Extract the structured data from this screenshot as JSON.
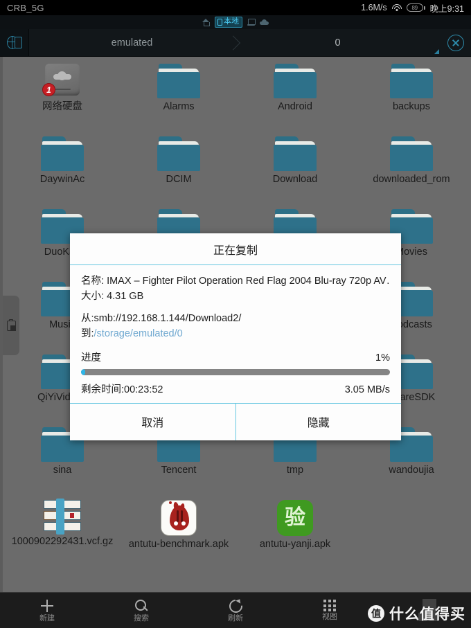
{
  "status_bar": {
    "carrier": "CRB_5G",
    "network_speed": "1.6M/s",
    "wifi_icon": "wifi-icon",
    "battery_level": "89",
    "clock": "晚上9:31"
  },
  "tab_strip": {
    "items": [
      {
        "icon": "home-icon",
        "label": "",
        "active": false
      },
      {
        "icon": "phone-icon",
        "label": "本地",
        "active": true
      },
      {
        "icon": "pc-icon",
        "label": "",
        "active": false
      },
      {
        "icon": "cloud-icon",
        "label": "",
        "active": false
      }
    ]
  },
  "path_bar": {
    "left_icon": "globe-device-icon",
    "crumbs": [
      "emulated",
      "0"
    ],
    "close_icon": "close-circle-icon"
  },
  "side_handle": {
    "icon": "clipboard-icon"
  },
  "files": [
    {
      "name": "网络硬盘",
      "type": "network-drive",
      "badge": "1"
    },
    {
      "name": "Alarms",
      "type": "folder"
    },
    {
      "name": "Android",
      "type": "folder"
    },
    {
      "name": "backups",
      "type": "folder"
    },
    {
      "name": "DaywinAc",
      "type": "folder"
    },
    {
      "name": "DCIM",
      "type": "folder"
    },
    {
      "name": "Download",
      "type": "folder"
    },
    {
      "name": "downloaded_rom",
      "type": "folder"
    },
    {
      "name": "DuoKan",
      "type": "folder"
    },
    {
      "name": "",
      "type": "folder"
    },
    {
      "name": "",
      "type": "folder"
    },
    {
      "name": "Movies",
      "type": "folder"
    },
    {
      "name": "Music",
      "type": "folder"
    },
    {
      "name": "",
      "type": "folder"
    },
    {
      "name": "",
      "type": "folder"
    },
    {
      "name": "Podcasts",
      "type": "folder"
    },
    {
      "name": "QiYiVideo_",
      "type": "folder"
    },
    {
      "name": "",
      "type": "folder"
    },
    {
      "name": "",
      "type": "folder"
    },
    {
      "name": "ShareSDK",
      "type": "folder"
    },
    {
      "name": "sina",
      "type": "folder"
    },
    {
      "name": "Tencent",
      "type": "folder"
    },
    {
      "name": "tmp",
      "type": "folder"
    },
    {
      "name": "wandoujia",
      "type": "folder"
    },
    {
      "name": "1000902292431.vcf.gz",
      "type": "vcf"
    },
    {
      "name": "antutu-benchmark.apk",
      "type": "apk-antutu"
    },
    {
      "name": "antutu-yanji.apk",
      "type": "apk-yanji",
      "glyph": "验"
    }
  ],
  "dialog": {
    "title": "正在复制",
    "name_label": "名称:",
    "name_value": "IMAX – Fighter Pilot  Operation Red Flag  2004  Blu-ray 720p AV…",
    "size_label": "大小:",
    "size_value": "4.31 GB",
    "from_label": "从:",
    "from_value": "smb://192.168.1.144/Download2/",
    "to_label": "到:",
    "to_value": "/storage/emulated/0",
    "progress_label": "进度",
    "progress_percent": "1%",
    "progress_value": 1,
    "remaining_label": "剩余时间:00:23:52",
    "speed": "3.05 MB/s",
    "cancel_label": "取消",
    "hide_label": "隐藏",
    "accent_color": "#63c6e0",
    "bar_fill_color": "#2fb6e8",
    "bar_track_color": "#848484"
  },
  "bottom_nav": {
    "items": [
      {
        "icon": "plus-icon",
        "label": "新建"
      },
      {
        "icon": "search-icon",
        "label": "搜索"
      },
      {
        "icon": "refresh-icon",
        "label": "刷新"
      },
      {
        "icon": "grid-icon",
        "label": "视图"
      }
    ],
    "watermark_logo": "值",
    "watermark_text": "什么值得买"
  }
}
